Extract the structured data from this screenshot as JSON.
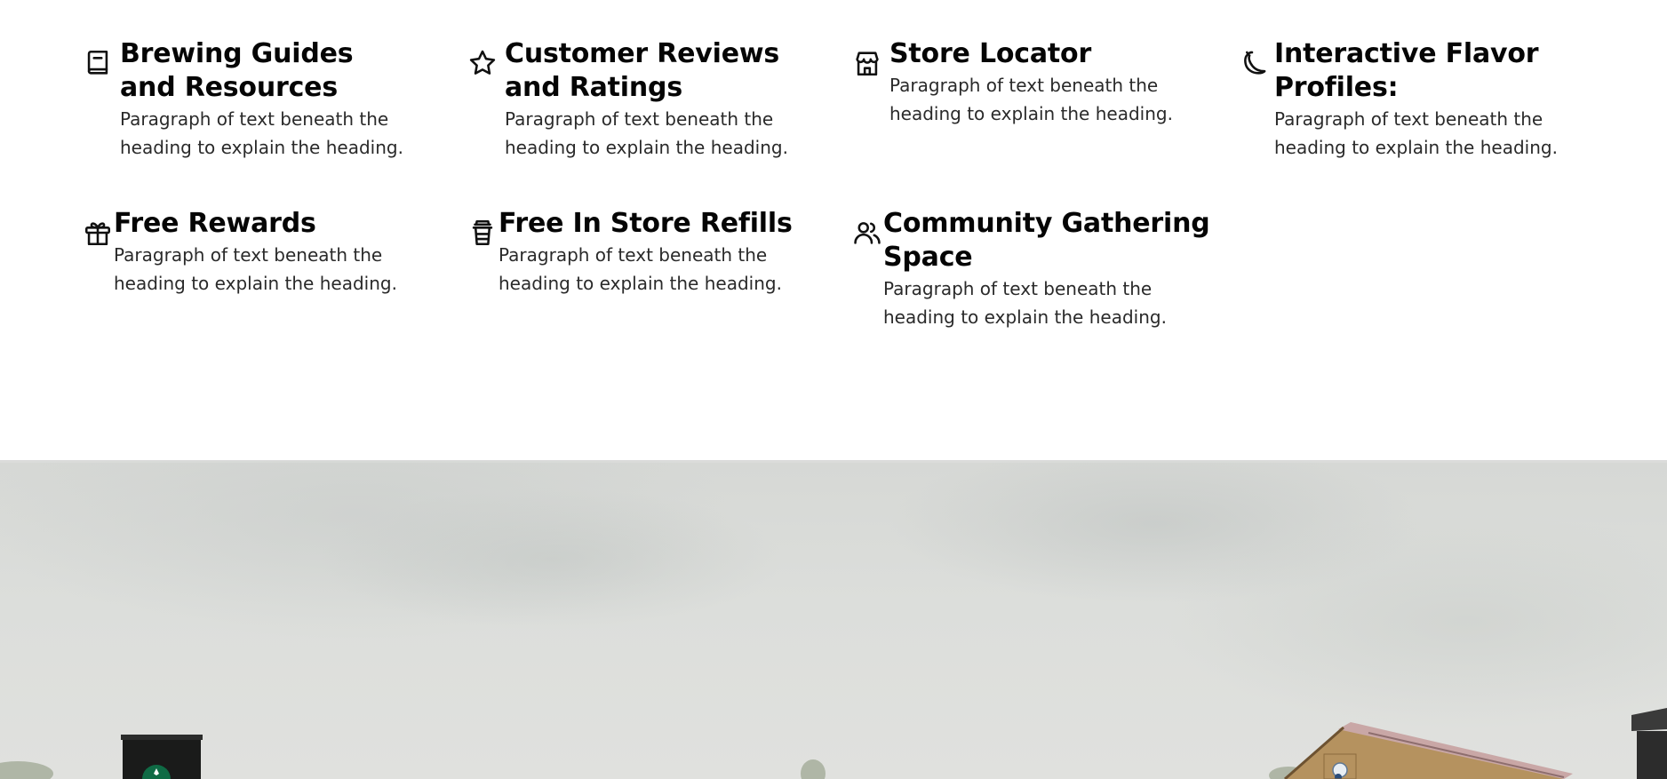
{
  "features": [
    {
      "icon": "book-icon",
      "title": "Brewing Guides and Resources",
      "text": "Paragraph of text beneath the heading to explain the heading."
    },
    {
      "icon": "star-icon",
      "title": "Customer Reviews and Ratings",
      "text": "Paragraph of text beneath the heading to explain the heading."
    },
    {
      "icon": "store-icon",
      "title": "Store Locator",
      "text": "Paragraph of text beneath the heading to explain the heading."
    },
    {
      "icon": "pepper-icon",
      "title": "Interactive Flavor Profiles:",
      "text": "Paragraph of text beneath the heading to explain the heading."
    },
    {
      "icon": "gift-icon",
      "title": "Free Rewards",
      "text": "Paragraph of text beneath the heading to explain the heading."
    },
    {
      "icon": "cup-icon",
      "title": "Free In Store Refills",
      "text": "Paragraph of text beneath the heading to explain the heading."
    },
    {
      "icon": "users-icon",
      "title": "Community Gathering Space",
      "text": "Paragraph of text beneath the heading to explain the heading."
    }
  ],
  "colors": {
    "heading": "#050505",
    "body_text": "#2a2a2a",
    "divider": "#d9d9d9",
    "sign_green": "#00704a"
  }
}
